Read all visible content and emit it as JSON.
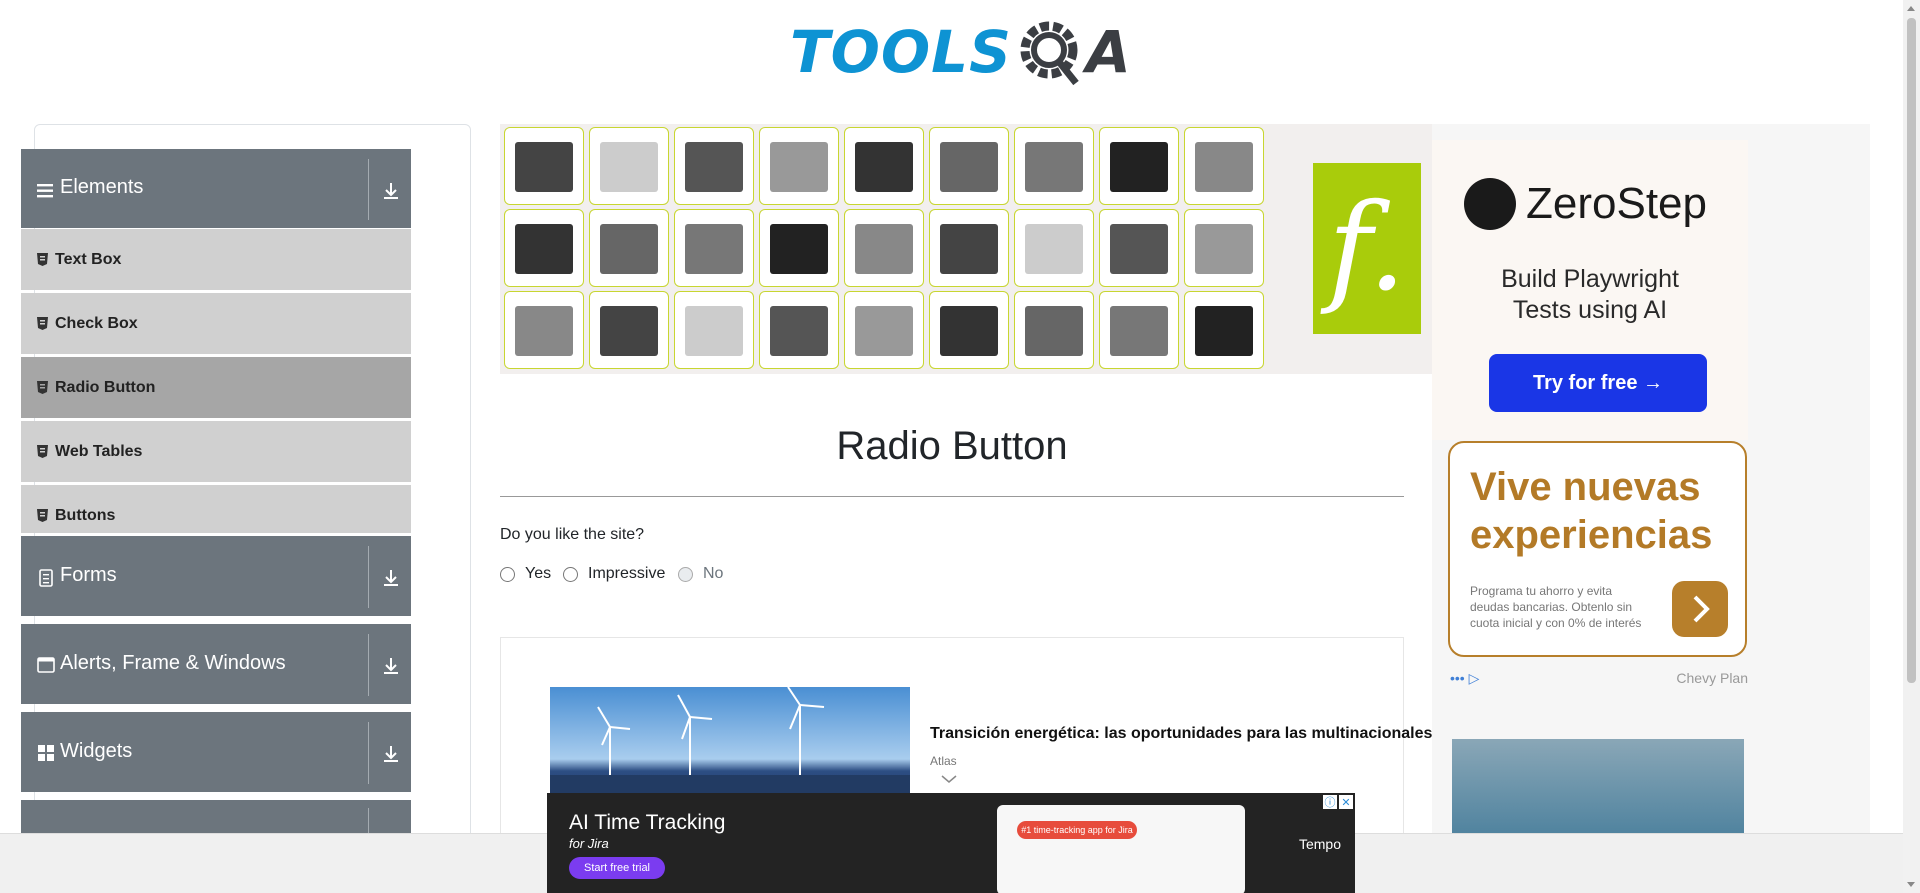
{
  "header": {
    "logo_left": "TOOLS",
    "logo_right": "A"
  },
  "sidebar": {
    "groups": [
      {
        "title": "Elements",
        "icon": "hamburger-icon"
      },
      {
        "title": "Forms",
        "icon": "document-icon"
      },
      {
        "title": "Alerts, Frame & Windows",
        "icon": "window-icon"
      },
      {
        "title": "Widgets",
        "icon": "grid-icon"
      }
    ],
    "items": [
      "Text Box",
      "Check Box",
      "Radio Button",
      "Web Tables",
      "Buttons"
    ],
    "active_item": "Radio Button"
  },
  "main": {
    "title": "Radio Button",
    "question": "Do you like the site?",
    "options": [
      {
        "label": "Yes",
        "disabled": false
      },
      {
        "label": "Impressive",
        "disabled": false
      },
      {
        "label": "No",
        "disabled": true
      }
    ]
  },
  "news_ad": {
    "title": "Transición energética: las oportunidades para las multinacionales",
    "source": "Atlas"
  },
  "right_ads": {
    "zerostep": {
      "brand": "ZeroStep",
      "tagline_1": "Build Playwright",
      "tagline_2": "Tests using AI",
      "cta": "Try for free →"
    },
    "vive": {
      "title_1": "Vive nuevas",
      "title_2": "experiencias",
      "desc": "Programa tu ahorro y evita deudas bancarias. Obtenlo sin cuota inicial y con 0% de interés",
      "footer_right": "Chevy Plan"
    }
  },
  "bottom_ad": {
    "title": "AI Time Tracking",
    "for": "for  Jira",
    "cta": "Start free trial",
    "pill": "#1 time-tracking app for Jira",
    "brand": "Tempo"
  },
  "colors": {
    "sidebar_group": "#6c757d",
    "sidebar_item": "#d0d0d0",
    "sidebar_active": "#a6a6a6",
    "logo_blue": "#0e93d3",
    "ad_border": "#c8d631"
  }
}
